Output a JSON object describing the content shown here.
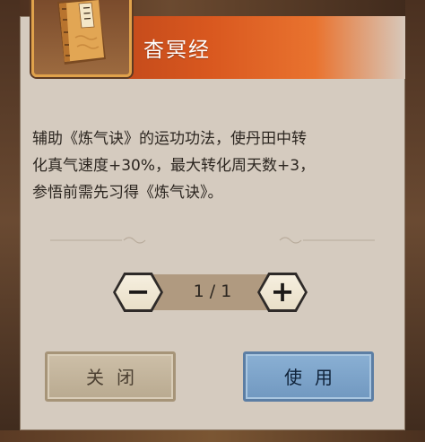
{
  "item": {
    "title": "杳冥经",
    "icon": "book-icon",
    "description_lines": [
      "辅助《炼气诀》的运功功法，使丹田中转",
      "化真气速度+30%，最大转化周天数+3，",
      "参悟前需先习得《炼气诀》。"
    ]
  },
  "stepper": {
    "value": "1 / 1",
    "minus_label": "−",
    "plus_label": "+"
  },
  "buttons": {
    "close_label": "关闭",
    "use_label": "使用"
  },
  "colors": {
    "header_accent": "#d9581f",
    "panel_bg": "#d5cbbf",
    "use_button": "#7da5cb",
    "close_button": "#c4b59c"
  }
}
